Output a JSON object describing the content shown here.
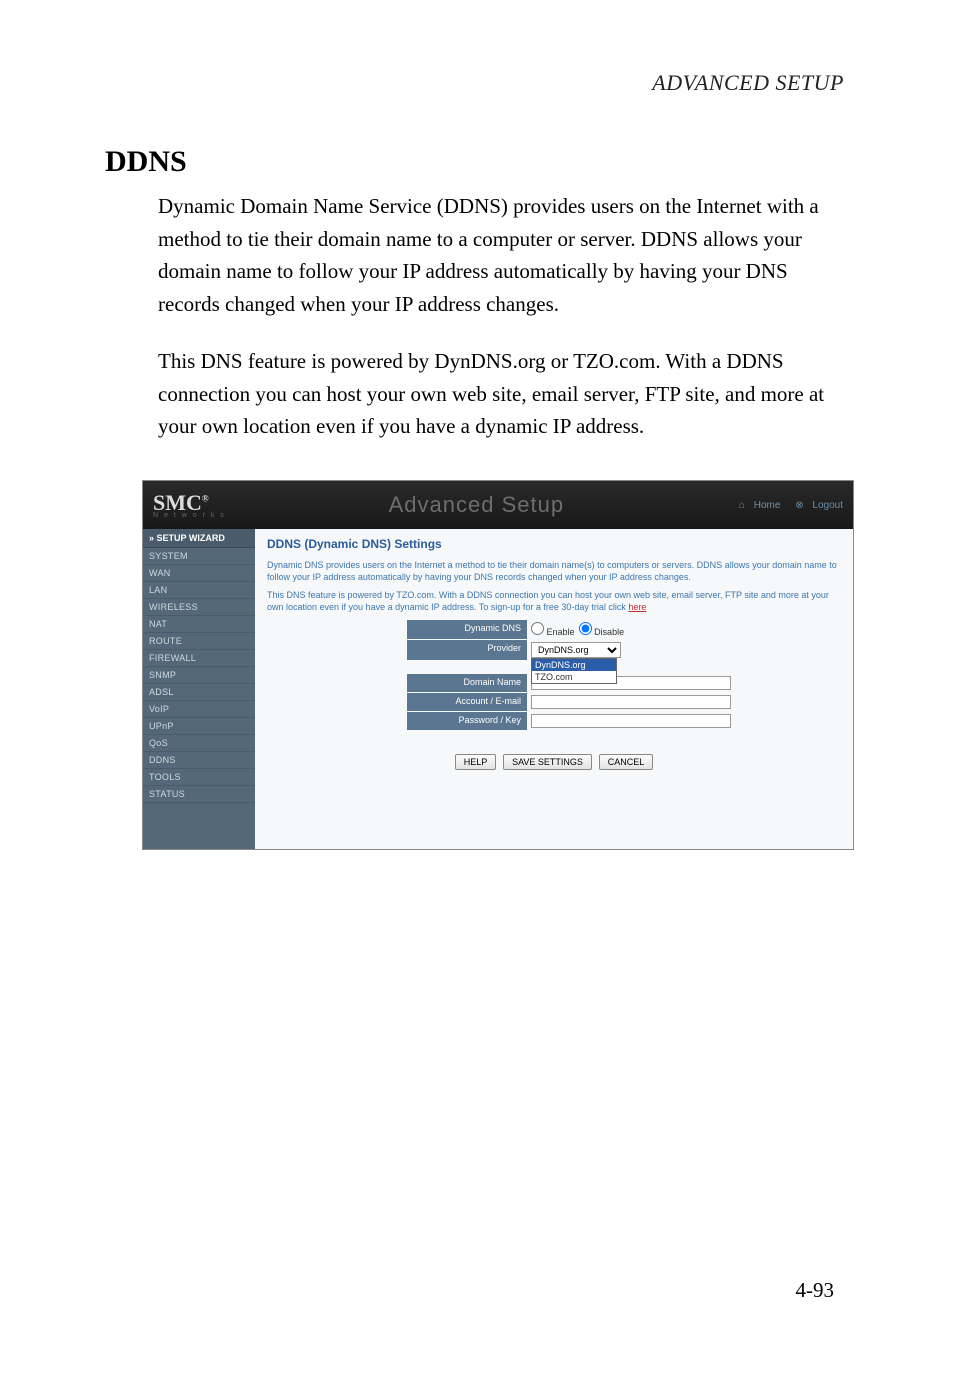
{
  "page_header": "ADVANCED SETUP",
  "section_heading": "DDNS",
  "paragraph1": "Dynamic Domain Name Service (DDNS) provides users on the Internet with a method to tie their domain name to a computer or server. DDNS allows your domain name to follow your IP address automatically by having your DNS records changed when your IP address changes.",
  "paragraph2": "This DNS feature is powered by DynDNS.org or TZO.com. With a DDNS connection you can host your own web site, email server, FTP site, and more at your own location even if you have a dynamic IP address.",
  "page_number": "4-93",
  "screenshot": {
    "logo_main": "SMC",
    "logo_sub": "N e t w o r k s",
    "header_title": "Advanced Setup",
    "header_home": "Home",
    "header_logout": "Logout",
    "sidebar": {
      "setup_wizard": "» SETUP WIZARD",
      "items": [
        {
          "label": "SYSTEM"
        },
        {
          "label": "WAN"
        },
        {
          "label": "LAN"
        },
        {
          "label": "WIRELESS"
        },
        {
          "label": "NAT"
        },
        {
          "label": "ROUTE"
        },
        {
          "label": "FIREWALL"
        },
        {
          "label": "SNMP"
        },
        {
          "label": "ADSL"
        },
        {
          "label": "VoIP"
        },
        {
          "label": "UPnP"
        },
        {
          "label": "QoS"
        },
        {
          "label": "DDNS"
        },
        {
          "label": "TOOLS"
        },
        {
          "label": "STATUS"
        }
      ]
    },
    "main": {
      "title": "DDNS (Dynamic DNS) Settings",
      "desc1": "Dynamic DNS provides users on the Internet a method to tie their domain name(s) to computers or servers. DDNS allows your domain name to follow your IP address automatically by having your DNS records changed when your IP address changes.",
      "desc2_prefix": "This DNS feature is powered by TZO.com. With a DDNS connection you can host your own web site, email server, FTP site and more at your own location even if you have a dynamic IP address. To sign-up for a free 30-day trial click ",
      "desc2_link": "here",
      "form": {
        "dynamic_dns_label": "Dynamic DNS",
        "enable_label": "Enable",
        "disable_label": "Disable",
        "provider_label": "Provider",
        "provider_selected": "DynDNS.org",
        "provider_options": [
          "DynDNS.org",
          "TZO.com"
        ],
        "domain_name_label": "Domain Name",
        "domain_name_value": "",
        "account_label": "Account / E-mail",
        "account_value": "",
        "password_label": "Password / Key",
        "password_value": ""
      },
      "buttons": {
        "help": "HELP",
        "save": "SAVE SETTINGS",
        "cancel": "CANCEL"
      }
    }
  }
}
